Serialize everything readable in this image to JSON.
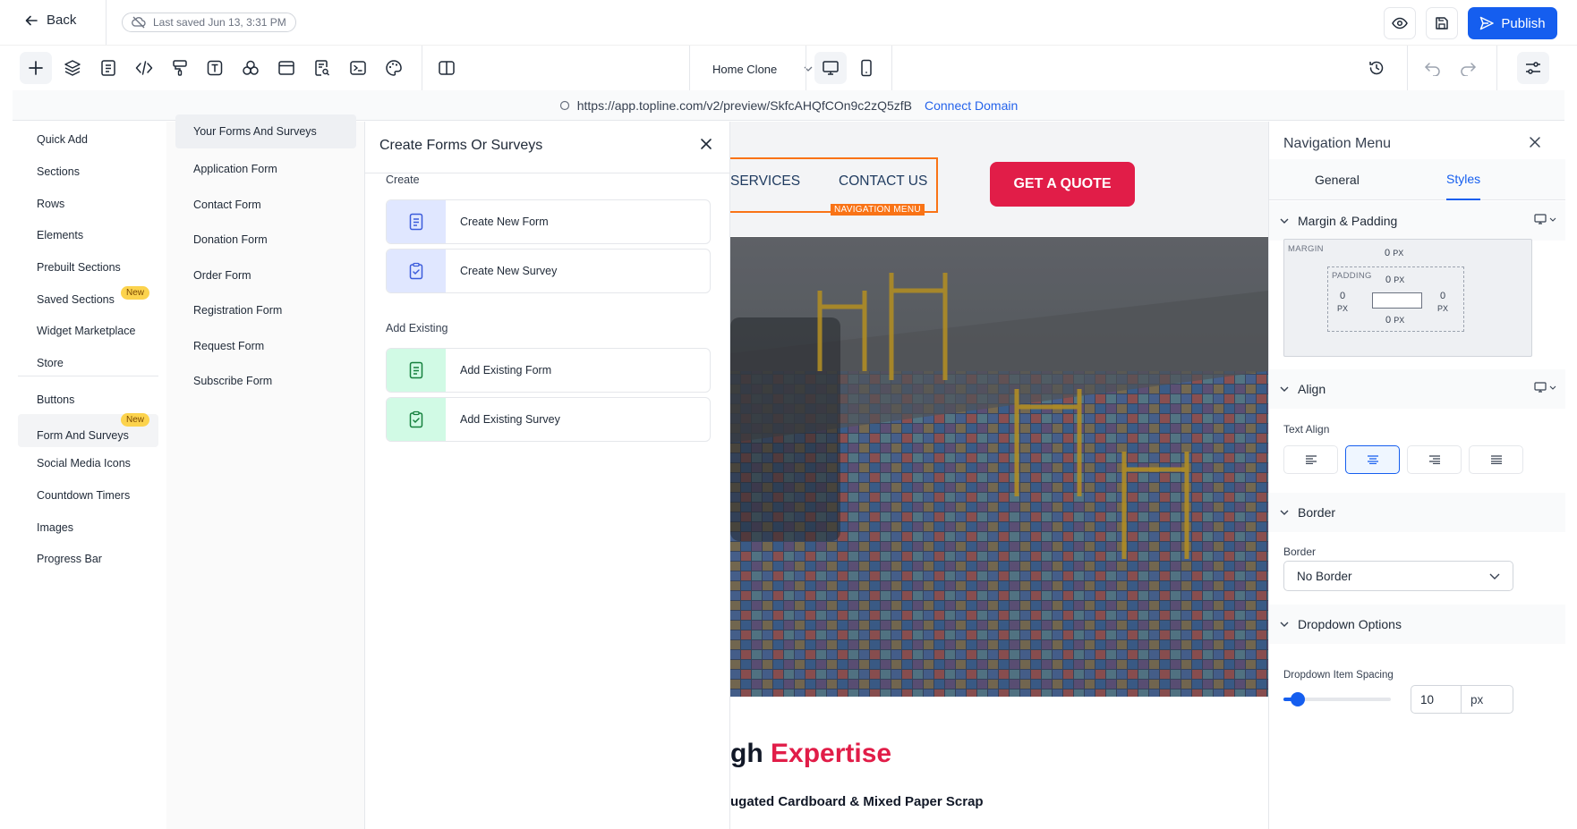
{
  "header": {
    "back_label": "Back",
    "last_saved": "Last saved Jun 13, 3:31 PM",
    "publish_label": "Publish",
    "page_select": "Home Clone",
    "accent": "#155eef"
  },
  "toolbar": {
    "icons": [
      "plus-icon",
      "layers-icon",
      "page-icon",
      "code-icon",
      "paint-roller-icon",
      "text-icon",
      "shapes-icon",
      "layout-icon",
      "search-doc-icon",
      "terminal-icon",
      "palette-icon",
      "split-view-icon"
    ]
  },
  "urlbar": {
    "url": "https://app.topline.com/v2/preview/SkfcAHQfCOn9c2zQ5zfB",
    "connect_label": "Connect Domain"
  },
  "leftnav": {
    "items_top": [
      "Quick Add",
      "Sections",
      "Rows",
      "Elements",
      "Prebuilt Sections",
      "Saved Sections",
      "Widget Marketplace",
      "Store"
    ],
    "items_bottom": [
      "Buttons",
      "Form And Surveys",
      "Social Media Icons",
      "Countdown Timers",
      "Images",
      "Progress Bar"
    ],
    "new_badge": "New"
  },
  "formslist": {
    "items": [
      "Your Forms And Surveys",
      "Application Form",
      "Contact Form",
      "Donation Form",
      "Order Form",
      "Registration Form",
      "Request Form",
      "Subscribe Form"
    ]
  },
  "createpanel": {
    "title": "Create Forms Or Surveys",
    "create_heading": "Create",
    "create_new_form": "Create New Form",
    "create_new_survey": "Create New Survey",
    "existing_heading": "Add Existing",
    "add_existing_form": "Add Existing Form",
    "add_existing_survey": "Add Existing Survey"
  },
  "canvas": {
    "nav_services": "SERVICES",
    "nav_contact": "CONTACT US",
    "nav_tag": "NAVIGATION MENU",
    "cta": "GET A QUOTE",
    "headline_prefix": "gh ",
    "headline_accent": "Expertise",
    "subline": "ugated Cardboard & Mixed Paper Scrap"
  },
  "rightpanel": {
    "title": "Navigation Menu",
    "tab_general": "General",
    "tab_styles": "Styles",
    "sec_margin": "Margin & Padding",
    "margin_label": "MARGIN",
    "padding_label": "PADDING",
    "margin_top": "0",
    "padding_top": "0",
    "padding_left": "0",
    "padding_right": "0",
    "padding_bottom": "0",
    "unit": "PX",
    "sec_align": "Align",
    "text_align_label": "Text Align",
    "sec_border": "Border",
    "border_label": "Border",
    "border_value": "No Border",
    "sec_dropdown": "Dropdown Options",
    "dropdown_spacing_label": "Dropdown Item Spacing",
    "dropdown_spacing_value": "10",
    "dropdown_spacing_unit": "px"
  }
}
